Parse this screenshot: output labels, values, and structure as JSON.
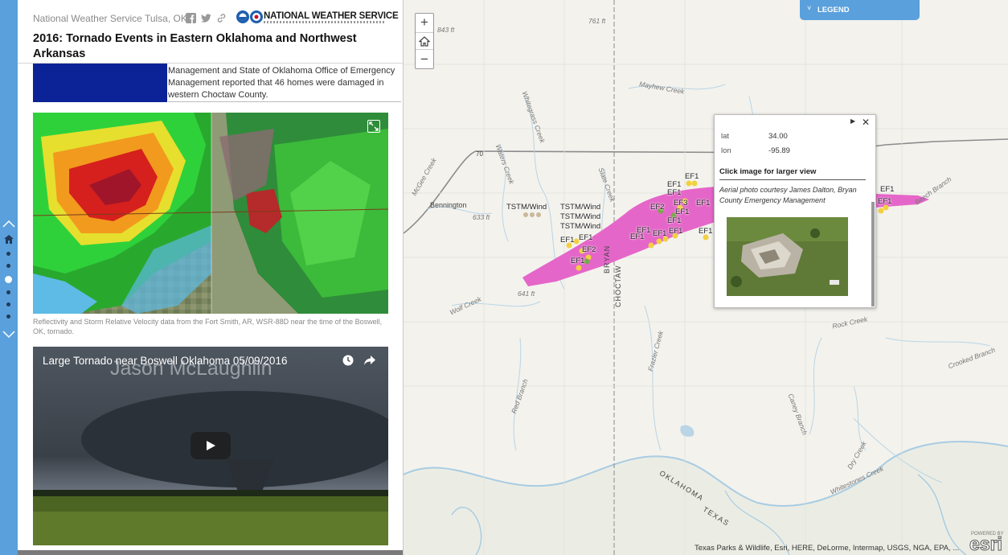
{
  "header": {
    "office": "National Weather Service Tulsa, OK",
    "logo_text": "NATIONAL WEATHER SERVICE",
    "title": "2016: Tornado Events in Eastern Oklahoma and Northwest Arkansas"
  },
  "previous_section": {
    "text": "Management and State of Oklahoma Office of Emergency Management reported that 46 homes were damaged in western Choctaw County."
  },
  "radar": {
    "caption": "Reflectivity and Storm Relative Velocity data from the Fort Smith, AR, WSR-88D near the time of the Boswell, OK, tornado."
  },
  "video": {
    "title": "Large Tornado near Boswell Oklahoma 05/09/2016",
    "watermark": "Jason McLaughlin"
  },
  "rail": {
    "up_icon": "chevron-up-icon",
    "home_icon": "home-icon",
    "down_icon": "chevron-down-icon",
    "dot_count": 6,
    "active_index": 2
  },
  "map": {
    "zoom_in": "+",
    "zoom_out": "−",
    "legend_label": "LEGEND",
    "popup": {
      "lat_label": "lat",
      "lat_value": "34.00",
      "lon_label": "lon",
      "lon_value": "-95.89",
      "heading": "Click image for larger view",
      "credit": "Aerial photo courtesy James Dalton, Bryan County Emergency Management"
    },
    "attribution": "Texas Parks & Wildlife, Esri, HERE, DeLorme, Intermap, USGS, NGA, EPA, ...",
    "esri": "esri",
    "esri_sub": "POWERED BY",
    "place_labels": {
      "bennington": "Bennington",
      "bryan": "BRYAN",
      "choctaw": "CHOCTAW",
      "oklahoma": "OKLAHOMA",
      "texas": "TEXAS",
      "route": "70"
    },
    "elevations": [
      "843 ft",
      "761 ft",
      "633 ft",
      "641 ft"
    ],
    "creeks": [
      "Mayhew Creek",
      "Whitegrass Creek",
      "Waters Creek",
      "McGee Creek",
      "Slate Creek",
      "Wolf Creek",
      "Red Branch",
      "Frazier Creek",
      "Rock Creek",
      "Crooked Branch",
      "Caney Branch",
      "Dry Creek",
      "Whitestones Creek",
      "Beech Branch"
    ],
    "event_labels": [
      "TSTM/Wind",
      "TSTM/Wind",
      "TSTM/Wind",
      "TSTM/Wind",
      "EF1",
      "EF1",
      "EF1",
      "EF1",
      "EF2",
      "EF1",
      "EF1",
      "EF1",
      "EF1",
      "EF2",
      "EF1",
      "EF3",
      "EF1",
      "EF1",
      "EF1",
      "EF1",
      "EF1",
      "EF1",
      "EF1"
    ],
    "colors": {
      "track": "#e566c9",
      "legend": "#5aa0dc",
      "event_dot": "#f2d040"
    }
  }
}
